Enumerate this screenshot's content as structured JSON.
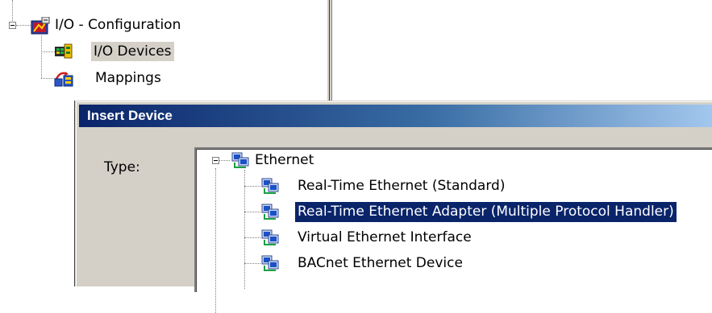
{
  "tree": {
    "root_label": "I/O - Configuration",
    "items": [
      {
        "label": "I/O Devices",
        "icon": "io-devices-icon",
        "selected": true
      },
      {
        "label": "Mappings",
        "icon": "mappings-icon",
        "selected": false
      }
    ]
  },
  "dialog": {
    "title": "Insert Device",
    "type_label": "Type:",
    "device_tree": {
      "root_label": "Ethernet",
      "items": [
        {
          "label": "Real-Time Ethernet (Standard)",
          "selected": false
        },
        {
          "label": "Real-Time Ethernet Adapter (Multiple Protocol Handler)",
          "selected": true
        },
        {
          "label": "Virtual Ethernet Interface",
          "selected": false
        },
        {
          "label": "BACnet Ethernet Device",
          "selected": false
        }
      ]
    }
  },
  "colors": {
    "selection_highlight": "#0a246a",
    "inactive_selection": "#d4d0c8",
    "dialog_face": "#d4d0c8"
  }
}
